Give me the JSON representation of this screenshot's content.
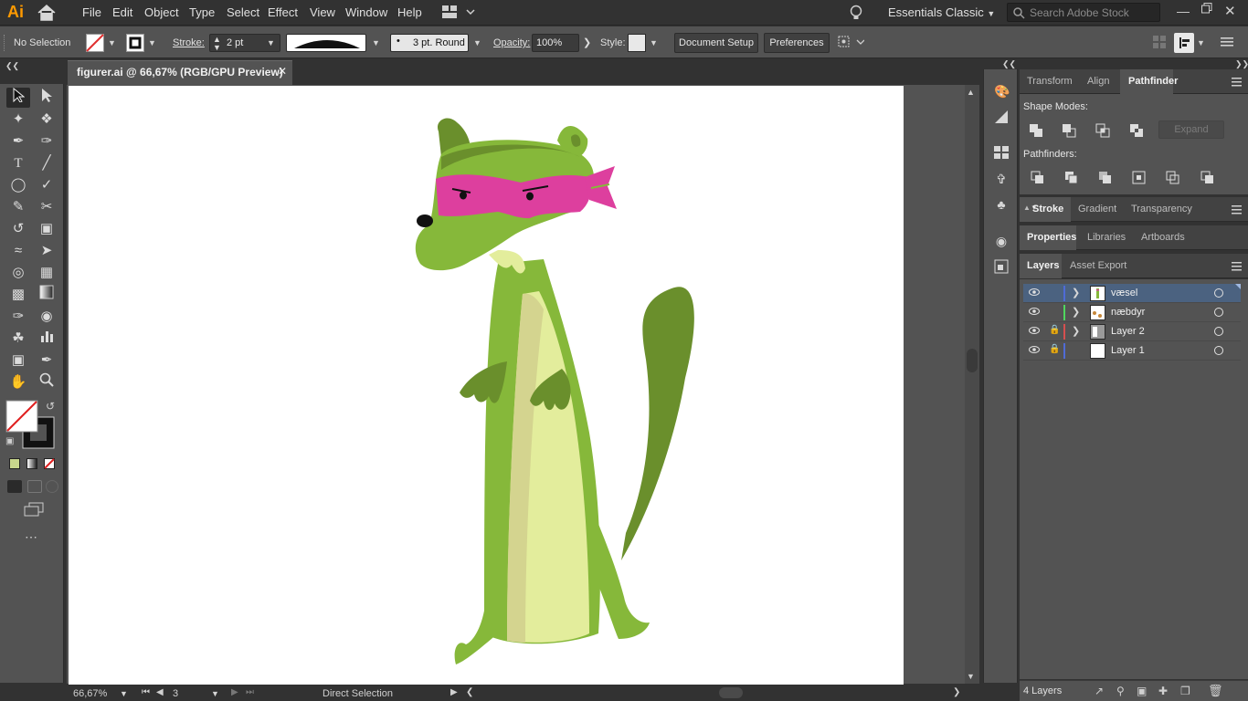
{
  "app": {
    "logo": "Ai",
    "workspace": "Essentials Classic",
    "stock_search_placeholder": "Search Adobe Stock"
  },
  "menus": [
    "File",
    "Edit",
    "Object",
    "Type",
    "Select",
    "Effect",
    "View",
    "Window",
    "Help"
  ],
  "control_bar": {
    "selection": "No Selection",
    "stroke_label": "Stroke:",
    "stroke_weight": "2 pt",
    "brush": "3 pt. Round",
    "opacity_label": "Opacity:",
    "opacity_value": "100%",
    "style_label": "Style:",
    "document_setup": "Document Setup",
    "preferences": "Preferences"
  },
  "document": {
    "tab_title": "figurer.ai @ 66,67% (RGB/GPU Preview)"
  },
  "status": {
    "zoom": "66,67%",
    "artboard_number": "3",
    "tool": "Direct Selection"
  },
  "panels": {
    "group1_tabs": [
      "Transform",
      "Align",
      "Pathfinder"
    ],
    "shape_modes_label": "Shape Modes:",
    "expand_label": "Expand",
    "pathfinders_label": "Pathfinders:",
    "group2_tabs": [
      "Stroke",
      "Gradient",
      "Transparency"
    ],
    "group3_tabs": [
      "Properties",
      "Libraries",
      "Artboards"
    ],
    "group4_tabs": [
      "Layers",
      "Asset Export"
    ],
    "layers": [
      {
        "name": "væsel",
        "color": "#4f6bd6",
        "locked": false
      },
      {
        "name": "næbdyr",
        "color": "#4fd65e",
        "locked": false
      },
      {
        "name": "Layer 2",
        "color": "#d64f4f",
        "locked": true
      },
      {
        "name": "Layer 1",
        "color": "#4f6bd6",
        "locked": true
      }
    ],
    "layers_count": "4 Layers"
  },
  "colors": {
    "mask": "#dd3f9e",
    "body": "#86b83a",
    "dark": "#6a8f2c",
    "belly": "#e3ed9c",
    "belly_shade": "#d4d48f"
  }
}
